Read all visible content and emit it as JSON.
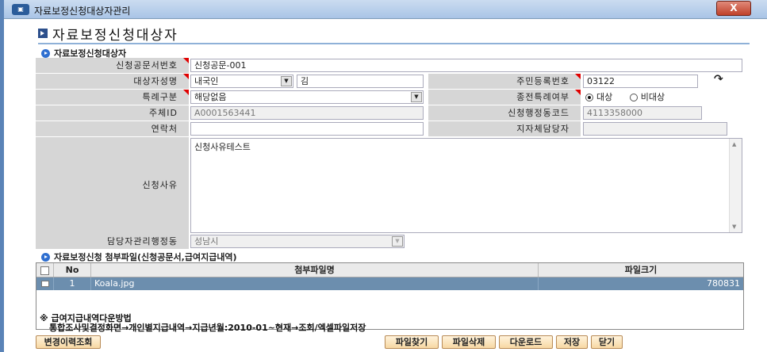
{
  "window": {
    "title": "자료보정신청대상자관리",
    "close_label": "X",
    "app_icon": "app-icon"
  },
  "page": {
    "title": "자료보정신청대상자"
  },
  "section1": {
    "title": "자료보정신청대상자"
  },
  "form": {
    "doc_no_label": "신청공문서번호",
    "doc_no_value": "신청공문-001",
    "target_name_label": "대상자성명",
    "nationality_value": "내국인",
    "name_value": "김",
    "resident_no_label": "주민등록번호",
    "resident_no_value": "03122",
    "special_type_label": "특례구분",
    "special_type_value": "해당없음",
    "prev_special_label": "종전특례여부",
    "radio_target_label": "대상",
    "radio_nontarget_label": "비대상",
    "radio_selected": "대상",
    "entity_id_label": "주체ID",
    "entity_id_value": "A0001563441",
    "agency_code_label": "신청행정동코드",
    "agency_code_value": "4113358000",
    "contact_label": "연락처",
    "contact_value": "",
    "local_officer_label": "지자체담당자",
    "local_officer_value": "",
    "reason_label": "신청사유",
    "reason_value": "신청사유테스트",
    "officer_dong_label": "담당자관리행정동",
    "officer_dong_value": "성남시"
  },
  "section2": {
    "title": "자료보정신청 첨부파일(신청공문서,급여지급내역)"
  },
  "attachments": {
    "headers": [
      "No",
      "첨부파일명",
      "파일크기"
    ],
    "rows": [
      {
        "no": "1",
        "name": "Koala.jpg",
        "size": "780831"
      }
    ]
  },
  "notes": {
    "line1": "※ 급여지급내역다운방법",
    "line2": "통합조사및결정화면→개인별지급내역→지급년월:2010-01~현재→조회/엑셀파일저장"
  },
  "buttons": {
    "history": "변경이력조회",
    "find_file": "파일찾기",
    "delete_file": "파일삭제",
    "download": "다운로드",
    "save": "저장",
    "close": "닫기"
  }
}
